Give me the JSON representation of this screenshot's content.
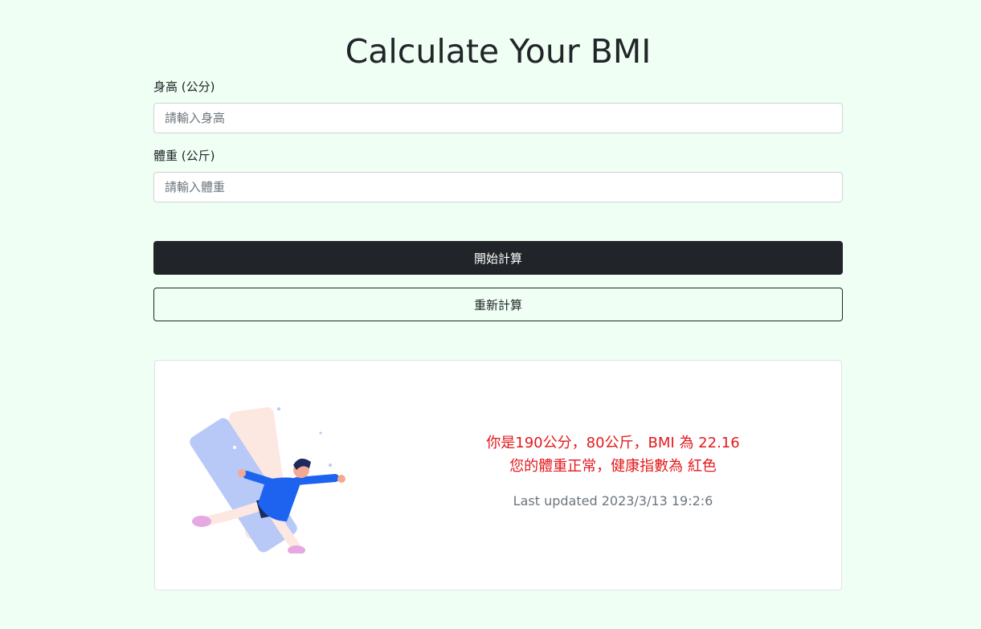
{
  "page": {
    "title": "Calculate Your BMI"
  },
  "form": {
    "height": {
      "label": "身高 (公分)",
      "placeholder": "請輸入身高",
      "value": ""
    },
    "weight": {
      "label": "體重 (公斤)",
      "placeholder": "請輸入體重",
      "value": ""
    }
  },
  "buttons": {
    "calculate": "開始計算",
    "reset": "重新計算"
  },
  "result": {
    "line1": "你是190公分，80公斤，BMI 為 22.16",
    "line2": "您的體重正常，健康指數為 紅色",
    "updated": "Last updated 2023/3/13 19:2:6",
    "text_color": "#e3191c",
    "illustration": "jumping-person-illustration"
  },
  "colors": {
    "page_background": "#f0fff4",
    "primary_button": "#212529",
    "card_background": "#ffffff"
  }
}
